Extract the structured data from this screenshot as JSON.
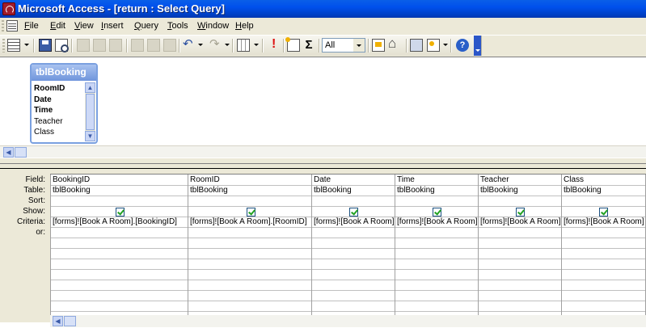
{
  "window": {
    "title": "Microsoft Access - [return : Select Query]"
  },
  "menu": [
    {
      "pre": "",
      "mn": "F",
      "post": "ile"
    },
    {
      "pre": "",
      "mn": "E",
      "post": "dit"
    },
    {
      "pre": "",
      "mn": "V",
      "post": "iew"
    },
    {
      "pre": "",
      "mn": "I",
      "post": "nsert"
    },
    {
      "pre": "",
      "mn": "Q",
      "post": "uery"
    },
    {
      "pre": "",
      "mn": "T",
      "post": "ools"
    },
    {
      "pre": "",
      "mn": "W",
      "post": "indow"
    },
    {
      "pre": "",
      "mn": "H",
      "post": "elp"
    }
  ],
  "toolbar": {
    "top_values": "All",
    "icons": [
      "view-icon",
      "save-icon",
      "search-icon",
      "print-icon",
      "print-preview-icon",
      "spelling-icon",
      "cut-icon",
      "copy-icon",
      "paste-icon",
      "undo-icon",
      "redo-icon",
      "query-type-icon",
      "run-icon",
      "show-table-icon",
      "totals-icon",
      "properties-icon",
      "builder-icon",
      "database-window-icon",
      "new-object-icon",
      "help-icon"
    ],
    "totals_glyph": "Σ",
    "help_glyph": "?"
  },
  "table_box": {
    "name": "tblBooking",
    "fields": [
      {
        "name": "RoomID",
        "key": true
      },
      {
        "name": "Date",
        "key": true
      },
      {
        "name": "Time",
        "key": true
      },
      {
        "name": "Teacher",
        "key": false
      },
      {
        "name": "Class",
        "key": false
      }
    ]
  },
  "grid": {
    "row_labels": [
      "Field:",
      "Table:",
      "Sort:",
      "Show:",
      "Criteria:",
      "or:"
    ],
    "columns": [
      {
        "field": "BookingID",
        "table": "tblBooking",
        "sort": "",
        "show": true,
        "criteria": "[forms]![Book A Room].[BookingID]",
        "or": ""
      },
      {
        "field": "RoomID",
        "table": "tblBooking",
        "sort": "",
        "show": true,
        "criteria": "[forms]![Book A Room].[RoomID]",
        "or": ""
      },
      {
        "field": "Date",
        "table": "tblBooking",
        "sort": "",
        "show": true,
        "criteria": "[forms]![Book A Room]",
        "or": ""
      },
      {
        "field": "Time",
        "table": "tblBooking",
        "sort": "",
        "show": true,
        "criteria": "[forms]![Book A Room]",
        "or": ""
      },
      {
        "field": "Teacher",
        "table": "tblBooking",
        "sort": "",
        "show": true,
        "criteria": "[forms]![Book A Room]",
        "or": ""
      },
      {
        "field": "Class",
        "table": "tblBooking",
        "sort": "",
        "show": true,
        "criteria": "[forms]![Book A Room]",
        "or": ""
      }
    ]
  }
}
